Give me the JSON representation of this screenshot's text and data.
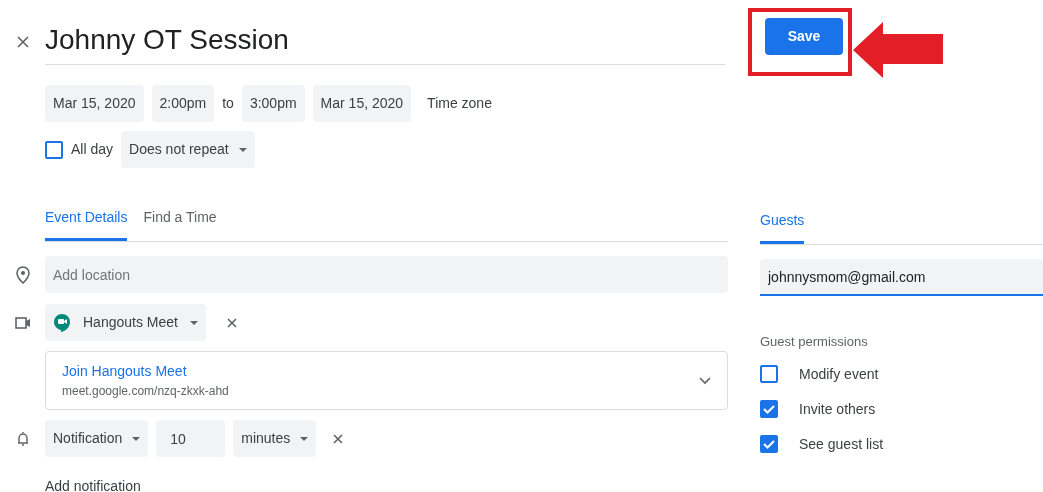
{
  "title": "Johnny OT Session",
  "dates": {
    "start_date": "Mar 15, 2020",
    "start_time": "2:00pm",
    "separator": "to",
    "end_time": "3:00pm",
    "end_date": "Mar 15, 2020",
    "time_zone": "Time zone"
  },
  "all_day": {
    "label": "All day",
    "checked": false
  },
  "repeat": "Does not repeat",
  "tabs": [
    {
      "label": "Event Details",
      "selected": true
    },
    {
      "label": "Find a Time",
      "selected": false
    }
  ],
  "location": {
    "placeholder": "Add location"
  },
  "conference": {
    "name": "Hangouts Meet",
    "link_title": "Join Hangouts Meet",
    "link_url": "meet.google.com/nzq-zkxk-ahd"
  },
  "notification": {
    "type": "Notification",
    "value": "10",
    "unit": "minutes"
  },
  "add_notification": "Add notification",
  "save_button": "Save",
  "guests_tab": {
    "label": "Guests",
    "selected": true
  },
  "guest_email": "johnnysmom@gmail.com",
  "permissions": {
    "title": "Guest permissions",
    "items": [
      {
        "label": "Modify event",
        "checked": false
      },
      {
        "label": "Invite others",
        "checked": true
      },
      {
        "label": "See guest list",
        "checked": true
      }
    ]
  }
}
